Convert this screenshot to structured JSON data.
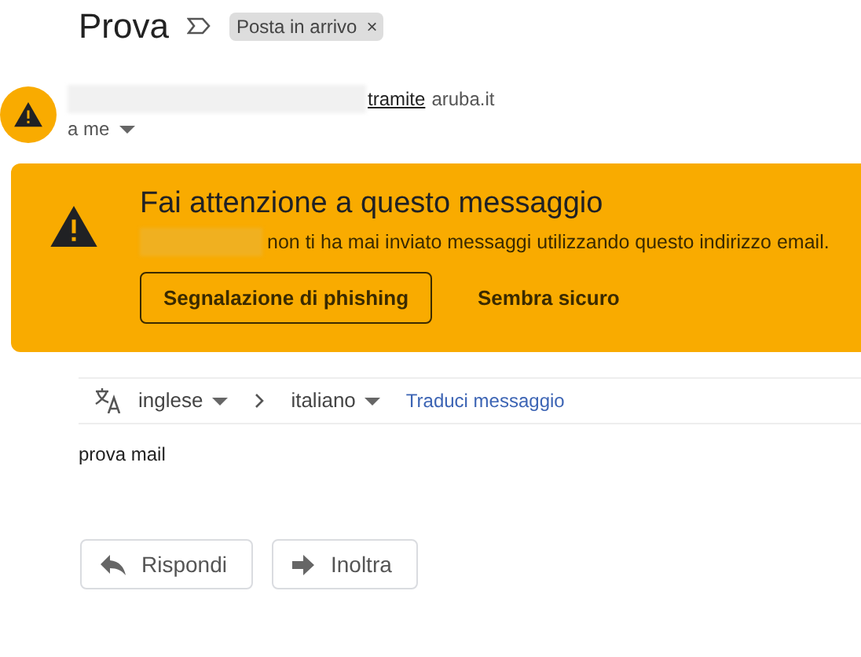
{
  "subject": "Prova",
  "label_chip": {
    "text": "Posta in arrivo",
    "close": "×"
  },
  "sender": {
    "via": "tramite",
    "domain": "aruba.it",
    "recipient": "a me"
  },
  "warning": {
    "title": "Fai attenzione a questo messaggio",
    "description": "non ti ha mai inviato messaggi utilizzando questo indirizzo email.",
    "buttons": [
      {
        "kind": "outlined",
        "label": "Segnalazione di phishing"
      },
      {
        "kind": "text",
        "label": "Sembra sicuro"
      }
    ]
  },
  "translate": {
    "from": "inglese",
    "to": "italiano",
    "action": "Traduci messaggio"
  },
  "body": "prova mail",
  "actions": [
    {
      "kind": "reply",
      "label": "Rispondi"
    },
    {
      "kind": "forward",
      "label": "Inoltra"
    }
  ]
}
